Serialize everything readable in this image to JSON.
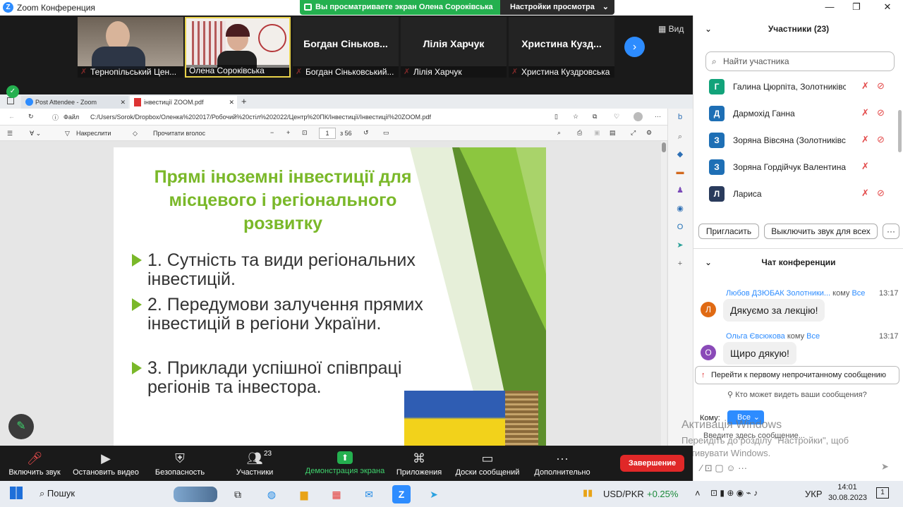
{
  "window": {
    "title": "Zoom Конференция",
    "logo": "Z"
  },
  "share_banner": {
    "text": "Вы просматриваете экран Олена Сороківська",
    "settings": "Настройки просмотра"
  },
  "video_strip": {
    "tiles": [
      {
        "name": "Тернопільський Цен..."
      },
      {
        "name": "Олена Сороківська"
      },
      {
        "name": "Богдан Сіньковський...",
        "big": "Богдан Сіньков..."
      },
      {
        "name": "Лілія Харчук",
        "big": "Лілія Харчук"
      },
      {
        "name": "Христина Куздровська",
        "big": "Христина Кузд..."
      }
    ],
    "view_label": "Вид"
  },
  "browser": {
    "tabs": [
      {
        "label": "Post Attendee - Zoom"
      },
      {
        "label": "інвестиції ZOOM.pdf"
      }
    ],
    "file_label": "Файл",
    "url": "C:/Users/Sorok/Dropbox/Оленка%202017/Робочий%20стіл%202022/Центр%20ПК/Інвестиції/Інвестиції%20ZOOM.pdf"
  },
  "pdf_toolbar": {
    "draw": "Накреслити",
    "read_aloud": "Прочитати вголос",
    "page": "1",
    "total": "з 56"
  },
  "slide": {
    "title": "Прямі іноземні інвестиції для місцевого і регіонального розвитку",
    "bullets": [
      "1. Сутність та види регіональних інвестицій.",
      "2. Передумови залучення прямих інвестицій в регіони України.",
      "3. Приклади успішної співпраці регіонів та інвестора."
    ]
  },
  "participants": {
    "header": "Участники (23)",
    "search_placeholder": "Найти участника",
    "list": [
      {
        "initial": "Г",
        "name": "Галина Цюрпіта, Золотниківсь...",
        "color": "#12a37a"
      },
      {
        "initial": "Д",
        "name": "Дармохід Ганна",
        "color": "#1e6fb5"
      },
      {
        "initial": "З",
        "name": "Зоряна Вівсяна (Золотниківсь...",
        "color": "#1e6fb5"
      },
      {
        "initial": "З",
        "name": "Зоряна Гордійчук Валентина Кури...",
        "color": "#1e6fb5"
      },
      {
        "initial": "Л",
        "name": "Лариса",
        "color": "#2a3b5c"
      }
    ],
    "invite": "Пригласить",
    "mute_all": "Выключить звук для всех",
    "more": "···"
  },
  "chat": {
    "header": "Чат конференции",
    "messages": [
      {
        "initial": "Л",
        "sender": "Любов ДЗЮБАК Золотники...",
        "to_label": "кому",
        "to": "Все",
        "time": "13:17",
        "text": "Дякуємо  за лекцію!",
        "color": "#e06a13"
      },
      {
        "initial": "О",
        "sender": "Ольга Євсюкова",
        "to_label": "кому",
        "to": "Все",
        "time": "13:17",
        "text": "Щиро дякую!",
        "color": "#8a4ab8"
      }
    ],
    "unread": "Перейти к первому непрочитанному сообщению",
    "who_sees": "Кто может видеть ваши сообщения?",
    "to_label": "Кому:",
    "to_value": "Все",
    "input_placeholder": "Введите здесь сообщение..."
  },
  "watermark": {
    "title": "Активація Windows",
    "line1": "Перейдіть до розділу \"Настройки\", щоб",
    "line2": "активувати Windows."
  },
  "toolbar": {
    "items": [
      {
        "label": "Включить звук",
        "icon": "mic-off-icon"
      },
      {
        "label": "Остановить видео",
        "icon": "video-icon"
      },
      {
        "label": "Безопасность",
        "icon": "shield-icon"
      },
      {
        "label": "Участники",
        "icon": "participants-icon",
        "count": "23"
      },
      {
        "label": "Демонстрация экрана",
        "icon": "share-icon"
      },
      {
        "label": "Приложения",
        "icon": "apps-icon"
      },
      {
        "label": "Доски сообщений",
        "icon": "whiteboard-icon"
      },
      {
        "label": "Дополнительно",
        "icon": "more-icon"
      }
    ],
    "end": "Завершение",
    "colors": {
      "share": "#24b04f",
      "end": "#e02828"
    }
  },
  "taskbar": {
    "search": "Пошук",
    "ticker": "USD/PKR",
    "ticker_change": "+0.25%",
    "lang": "УКР",
    "time": "14:01",
    "date": "30.08.2023",
    "notifications": "1"
  }
}
